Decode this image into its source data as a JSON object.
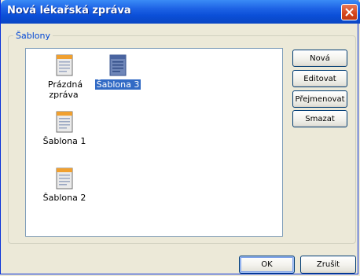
{
  "window": {
    "title": "Nová lékařská zpráva"
  },
  "group": {
    "label": "Šablony"
  },
  "templates": [
    {
      "label": "Prázdná zpráva",
      "selected": false
    },
    {
      "label": "Šablona 3",
      "selected": true
    },
    {
      "label": "Šablona 1",
      "selected": false
    },
    {
      "label": "Šablona 2",
      "selected": false
    }
  ],
  "side_buttons": {
    "new_label": "Nová",
    "edit_label": "Editovat",
    "rename_label": "Přejmenovat",
    "delete_label": "Smazat"
  },
  "footer": {
    "ok_label": "OK",
    "cancel_label": "Zrušit"
  },
  "colors": {
    "titlebar": "#0b4fd8",
    "selection": "#316ac5",
    "group_label": "#0046d5"
  }
}
